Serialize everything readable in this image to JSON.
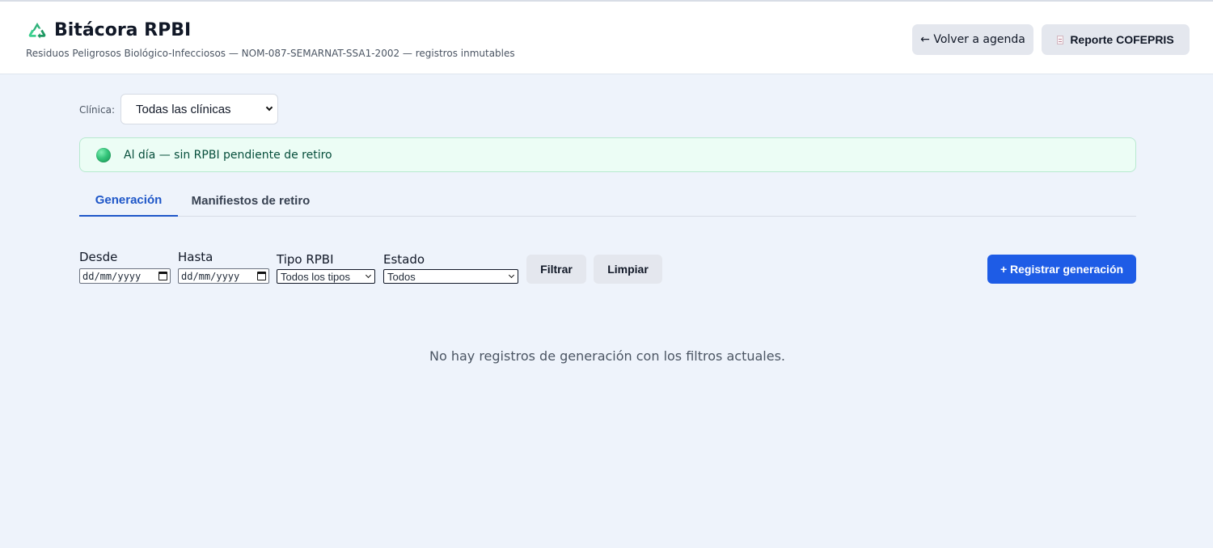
{
  "header": {
    "title": "Bitácora RPBI",
    "icon": "recycle-icon",
    "subtitle": "Residuos Peligrosos Biológico-Infecciosos — NOM-087-SEMARNAT-SSA1-2002 — registros inmutables",
    "back_button": "← Volver a agenda",
    "report_button": "Reporte COFEPRIS",
    "report_icon": "document-icon"
  },
  "clinic_filter": {
    "label": "Clínica:",
    "selected": "Todas las clínicas"
  },
  "status": {
    "text": "Al día — sin RPBI pendiente de retiro",
    "color": "#34c47a"
  },
  "tabs": [
    {
      "label": "Generación",
      "active": true
    },
    {
      "label": "Manifiestos de retiro",
      "active": false
    }
  ],
  "filters": {
    "from_label": "Desde",
    "from_value": "dd/mm/yyyy",
    "to_label": "Hasta",
    "to_value": "dd/mm/yyyy",
    "type_label": "Tipo RPBI",
    "type_selected": "Todos los tipos",
    "state_label": "Estado",
    "state_selected": "Todos",
    "filter_button": "Filtrar",
    "clear_button": "Limpiar",
    "register_button": "+ Registrar generación"
  },
  "empty_state": "No hay registros de generación con los filtros actuales.",
  "colors": {
    "accent": "#1e5ce6",
    "tab_active": "#1e56c8",
    "success_bg": "#ecfdf5"
  }
}
